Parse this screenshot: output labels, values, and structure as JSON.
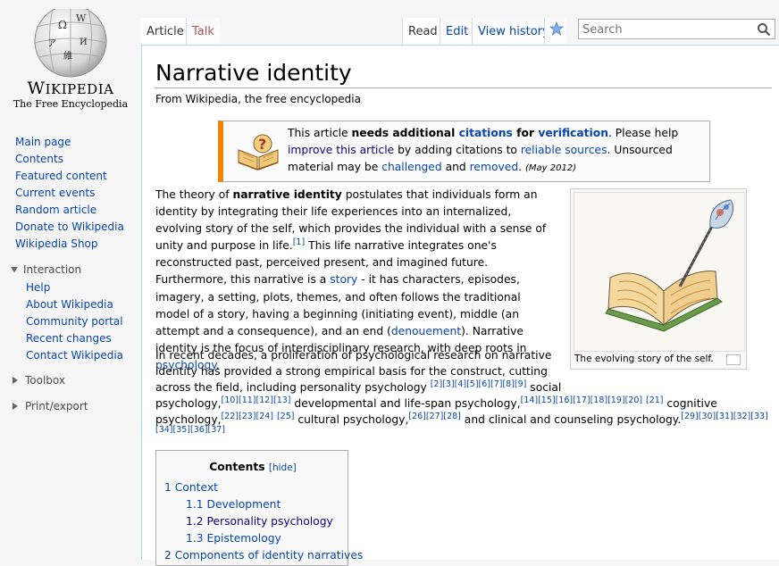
{
  "logo": {
    "wordmark": "Wikipedia",
    "tagline": "The Free Encyclopedia"
  },
  "sidebar": {
    "main_items": [
      "Main page",
      "Contents",
      "Featured content",
      "Current events",
      "Random article",
      "Donate to Wikipedia",
      "Wikipedia Shop"
    ],
    "interaction_heading": "Interaction",
    "interaction_items": [
      "Help",
      "About Wikipedia",
      "Community portal",
      "Recent changes",
      "Contact Wikipedia"
    ],
    "toolbox_heading": "Toolbox",
    "print_heading": "Print/export"
  },
  "tabs": {
    "article": "Article",
    "talk": "Talk",
    "read": "Read",
    "edit": "Edit",
    "history": "View history"
  },
  "search": {
    "placeholder": "Search"
  },
  "page": {
    "title": "Narrative identity",
    "from": "From Wikipedia, the free encyclopedia"
  },
  "ambox": {
    "t1": "This article ",
    "t2": "needs additional ",
    "t3": "citations",
    "t4": " for ",
    "t5": "verification",
    "t6": ". Please help ",
    "t7": "improve this article",
    "t8": " by adding citations to ",
    "t9": "reliable sources",
    "t10": ". Unsourced material may be ",
    "t11": "challenged",
    "t12": " and ",
    "t13": "removed",
    "t14": ".",
    "date": "(May 2012)"
  },
  "para1": {
    "a": "The theory of ",
    "b": "narrative identity",
    "c": " postulates that individuals form an identity by integrating their life experiences into an internalized, evolving story of the self, which provides the individual with a sense of unity and purpose in life.",
    "ref1": "[1]",
    "d": " This life narrative integrates one's reconstructed past, perceived present, and imagined future. Furthermore, this narrative is a ",
    "story": "story",
    "e": " - it has characters, episodes, imagery, a setting, plots, themes, and often follows the traditional model of a story, having a beginning (initiating event), middle (an attempt and a consequence), and an end (",
    "denouement": "denouement",
    "f": "). Narrative identity is the focus of interdisciplinary research, with deep roots in ",
    "psychology": "psychology",
    "g": "."
  },
  "para2": {
    "line1": "In recent decades, a proliferation of psychological research on narrative",
    "line2": "identity has provided a strong empirical basis for the construct, cutting",
    "line3a": "across the field, including personality psychology ",
    "refs_a": "[2][3][4][5][6][7][8][9]",
    "line3b": " social",
    "line4a": "psychology,",
    "refs_b": "[10][11][12][13]",
    "line4b": " developmental and life-span psychology,",
    "refs_c": "[14][15][16][17][18][19][20]",
    "refs_c2": "[21]",
    "line4c": " cognitive",
    "line5a": "psychology,",
    "refs_d": "[22][23][24]",
    "refs_d2": "[25]",
    "line5b": " cultural psychology,",
    "refs_e": "[26][27][28]",
    "line5c": " and clinical and counseling psychology.",
    "refs_f": "[29][30][31][32][33]",
    "refs_g": "[34][35][36][37]"
  },
  "thumb": {
    "caption": "The evolving story of the self."
  },
  "toc": {
    "title": "Contents",
    "hide": "[hide]",
    "items": [
      {
        "num": "1",
        "text": "Context"
      },
      {
        "num": "1.1",
        "text": "Development"
      },
      {
        "num": "1.2",
        "text": "Personality psychology"
      },
      {
        "num": "1.3",
        "text": "Epistemology"
      },
      {
        "num": "2",
        "text": "Components of identity narratives"
      }
    ]
  },
  "colors": {
    "link": "#0645ad",
    "visited": "#0b0080",
    "ambox_accent": "#f28500",
    "talk_red": "#a55858"
  }
}
